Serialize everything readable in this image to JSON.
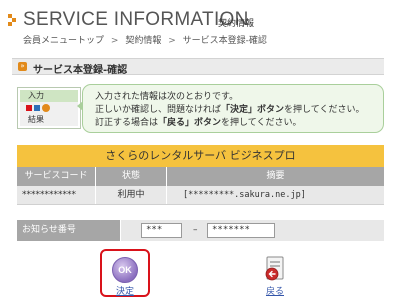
{
  "header": {
    "title": "SERVICE INFORMATION",
    "subtitle": "契約情報",
    "breadcrumb": [
      "会員メニュートップ",
      "契約情報",
      "サービス本登録-確認"
    ],
    "breadcrumb_sep": ">"
  },
  "section": {
    "title": "サービス本登録-確認"
  },
  "steps": [
    "入力",
    "",
    "結果"
  ],
  "message": {
    "line1": "入力された情報は次のとおりです。",
    "line2_pre": "正しいか確認し、問題なければ",
    "line2_bold": "「決定」ボタン",
    "line2_post": "を押してください。",
    "line3_pre": "訂正する場合は",
    "line3_bold": "「戻る」ボタン",
    "line3_post": "を押してください。"
  },
  "service_table": {
    "title": "さくらのレンタルサーバ ビジネスプロ",
    "headers": [
      "サービスコード",
      "状態",
      "摘要"
    ],
    "rows": [
      {
        "code": "************",
        "status": "利用中",
        "note": "[*********.sakura.ne.jp]"
      }
    ]
  },
  "notice": {
    "label": "お知らせ番号",
    "part1": "***",
    "dash": "–",
    "part2": "*******"
  },
  "buttons": {
    "ok_icon_text": "OK",
    "ok_label": "決定",
    "back_label": "戻る"
  },
  "colors": {
    "accent_orange": "#e28a1a",
    "table_title_bg": "#f5c23e",
    "header_gray": "#a6a6a6",
    "message_border": "#a9cf9b",
    "message_bg": "#eff7ea",
    "focus_red": "#d9121a"
  },
  "icons": {
    "header_mark": "orange-arrow-icon",
    "section": "orange-bullet-icon",
    "ok_button": "ok-circle-icon",
    "back_button": "document-back-icon"
  }
}
